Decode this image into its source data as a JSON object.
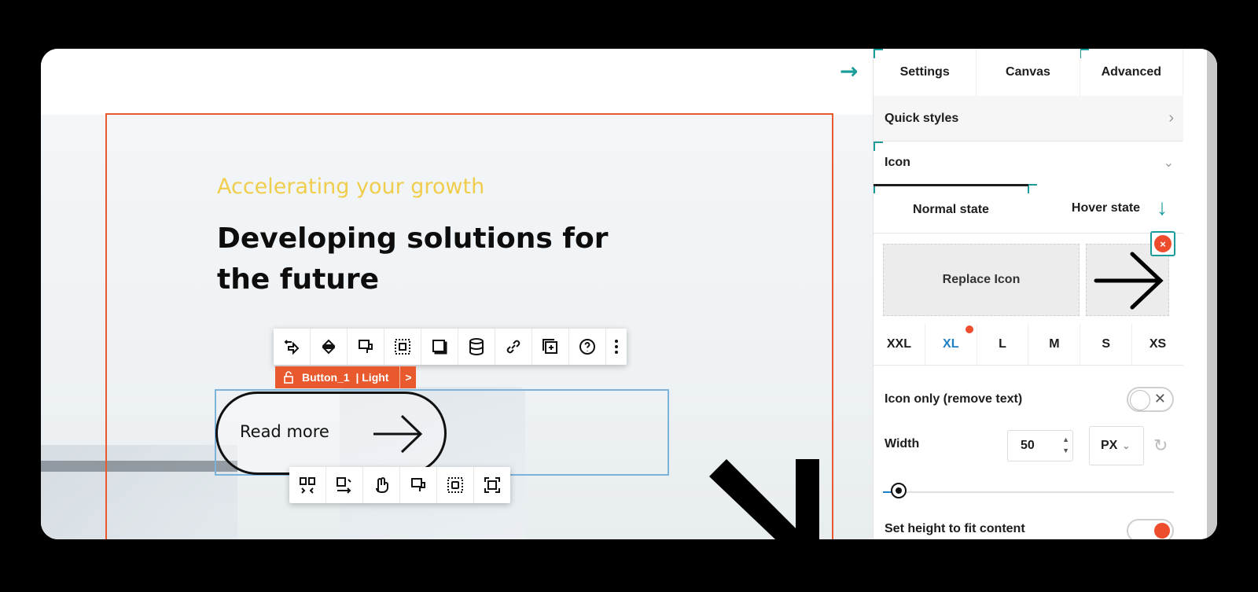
{
  "canvas": {
    "eyebrow": "Accelerating your growth",
    "headline": "Developing solutions for the future",
    "element_tag": {
      "name": "Button_1",
      "variant": "| Light",
      "nav": ">"
    },
    "button_text": "Read more",
    "colors": {
      "accent": "#e85a2d",
      "eyebrow": "#f0cd4c",
      "selection": "#7cb3da"
    },
    "top_toolbar_icons": [
      "move-icon",
      "align-icon",
      "copy-style-icon",
      "padding-icon",
      "shadow-icon",
      "database-icon",
      "link-icon",
      "add-icon",
      "help-icon",
      "more-icon"
    ],
    "bottom_toolbar_icons": [
      "columns-icon",
      "wrap-icon",
      "hand-icon",
      "paste-style-icon",
      "frame-icon",
      "fullscreen-icon"
    ]
  },
  "panel": {
    "tabs": [
      "Settings",
      "Canvas",
      "Advanced"
    ],
    "quick_styles": "Quick styles",
    "icon_section": "Icon",
    "states": [
      "Normal state",
      "Hover state"
    ],
    "replace_icon": "Replace Icon",
    "remove": "×",
    "sizes": [
      "XXL",
      "XL",
      "L",
      "M",
      "S",
      "XS"
    ],
    "active_size": "XL",
    "icon_only_label": "Icon only (remove text)",
    "width_label": "Width",
    "width_value": "50",
    "width_unit": "PX",
    "cut_label": "Set height to fit content",
    "accent": "#1f7fc4"
  }
}
